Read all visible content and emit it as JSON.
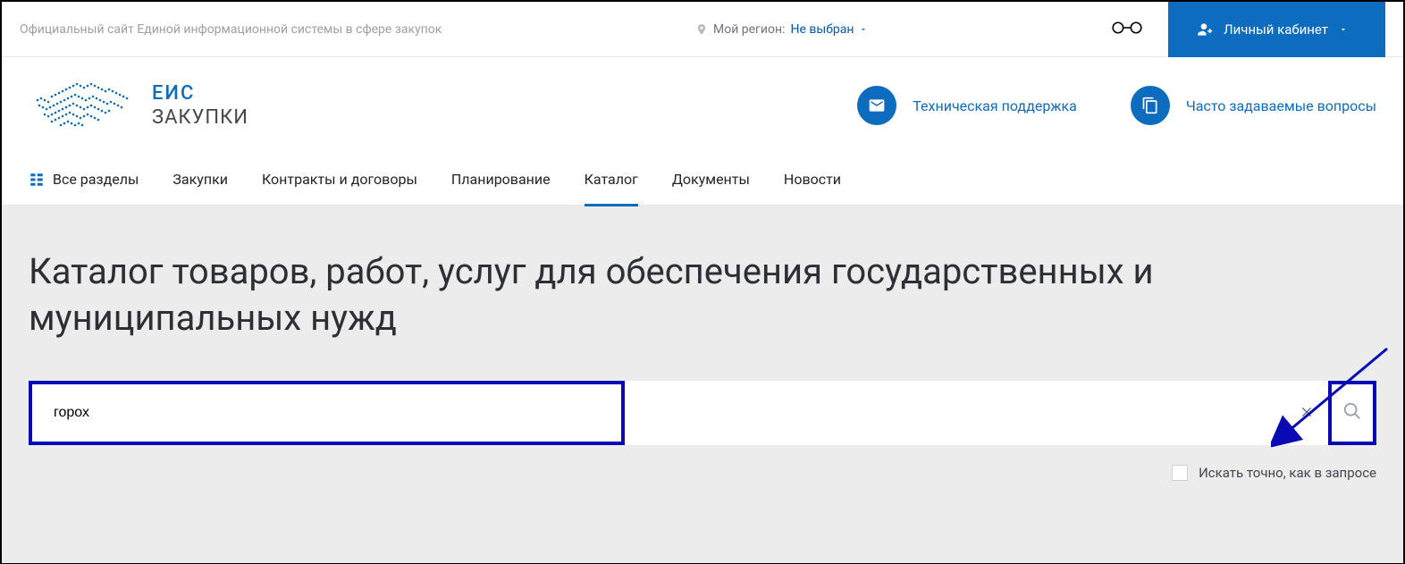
{
  "topbar": {
    "site_label": "Официальный сайт Единой информационной системы в сфере закупок",
    "region_prefix": "Мой регион:",
    "region_value": "Не выбран",
    "login_label": "Личный кабинет"
  },
  "logo": {
    "line1": "ЕИС",
    "line2": "ЗАКУПКИ"
  },
  "header_links": {
    "support": "Техническая поддержка",
    "faq": "Часто задаваемые вопросы"
  },
  "nav": {
    "all_sections": "Все разделы",
    "purchases": "Закупки",
    "contracts": "Контракты и договоры",
    "planning": "Планирование",
    "catalog": "Каталог",
    "documents": "Документы",
    "news": "Новости"
  },
  "page": {
    "title": "Каталог товаров, работ, услуг для обеспечения государственных и муниципальных нужд"
  },
  "search": {
    "value": "горох",
    "exact_label": "Искать точно, как в запросе"
  }
}
